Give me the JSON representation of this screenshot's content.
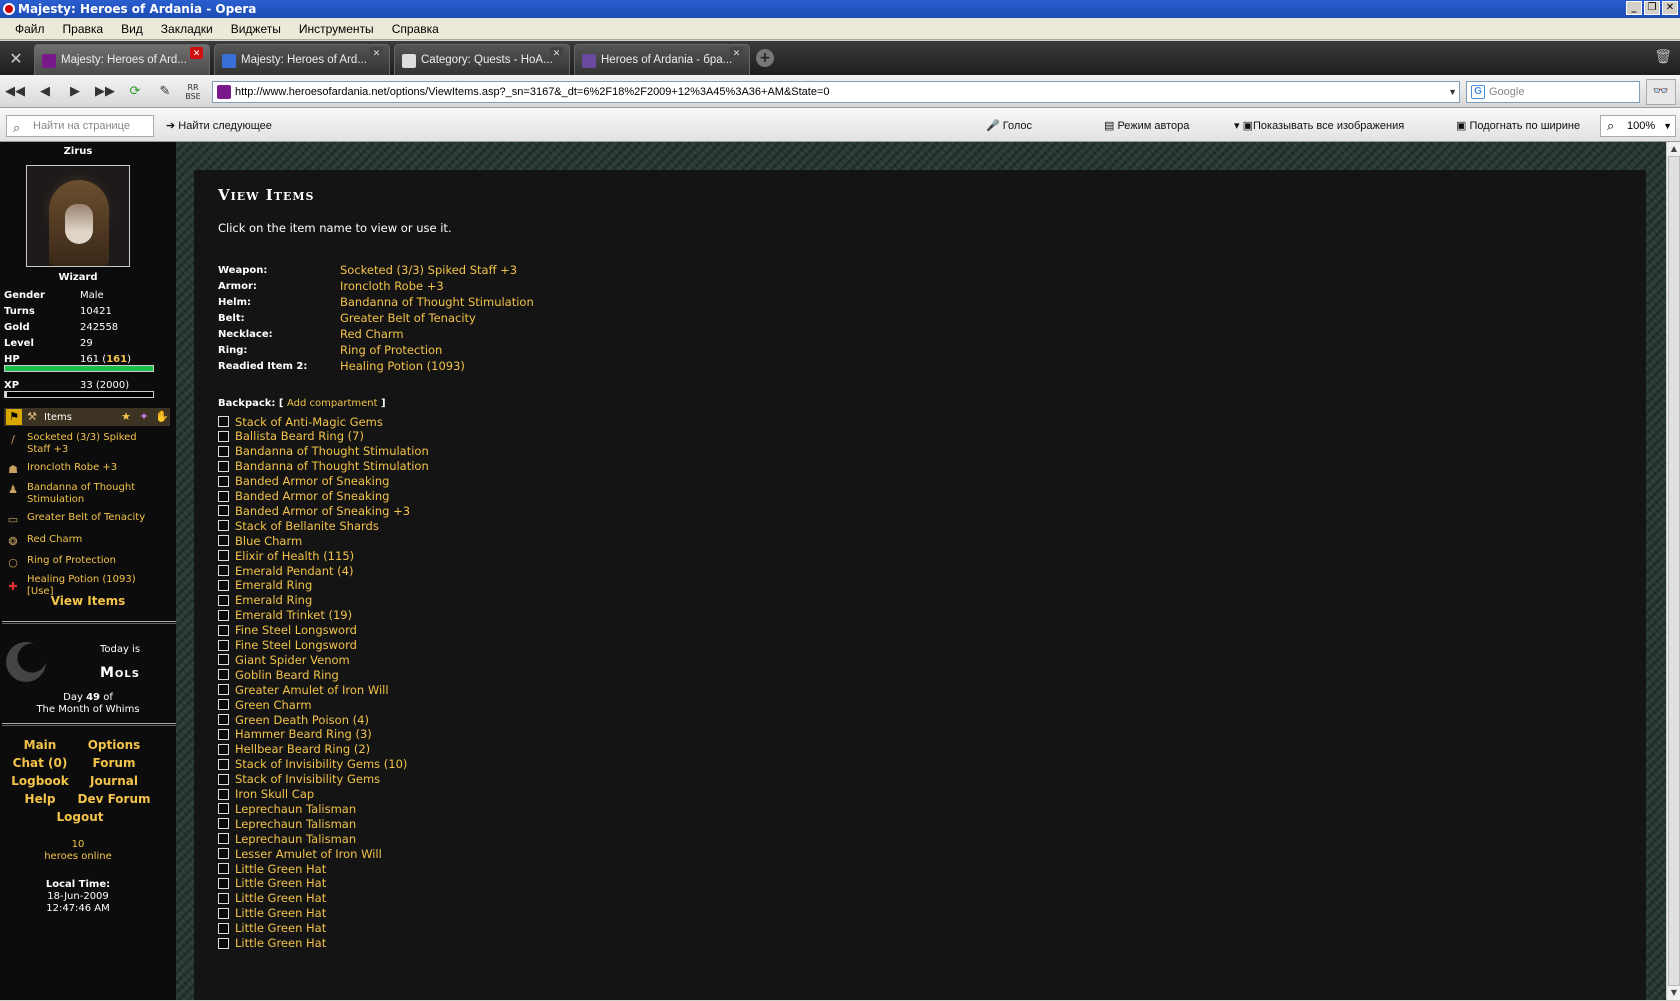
{
  "window": {
    "title": "Majesty: Heroes of Ardania - Opera"
  },
  "menu": [
    "Файл",
    "Правка",
    "Вид",
    "Закладки",
    "Виджеты",
    "Инструменты",
    "Справка"
  ],
  "tabs": [
    {
      "label": "Majesty: Heroes of Ard...",
      "active": true
    },
    {
      "label": "Majesty: Heroes of Ard..."
    },
    {
      "label": "Category: Quests - HoA..."
    },
    {
      "label": "Heroes of Ardania - бра..."
    }
  ],
  "address": {
    "url": "http://www.heroesofardania.net/options/ViewItems.asp?_sn=3167&_dt=6%2F18%2F2009+12%3A45%3A36+AM&State=0",
    "search_placeholder": "Google"
  },
  "findbar": {
    "find_placeholder": "Найти на странице",
    "find_next": "Найти следующее",
    "voice": "Голос",
    "author_mode": "Режим автора",
    "show_images": "Показывать все изображения",
    "fit_width": "Подогнать по ширине",
    "zoom": "100%"
  },
  "sidebar": {
    "name": "Zirus",
    "class": "Wizard",
    "stats": [
      {
        "label": "Gender",
        "value": "Male"
      },
      {
        "label": "Turns",
        "value": "10421"
      },
      {
        "label": "Gold",
        "value": "242558"
      },
      {
        "label": "Level",
        "value": "29"
      }
    ],
    "hp": {
      "label": "HP",
      "current": "161",
      "max": "161",
      "fraction": 1.0
    },
    "xp": {
      "label": "XP",
      "value": "33 (2000)",
      "fraction": 0.0165
    },
    "items_label": "Items",
    "equipped": [
      "Socketed (3/3) Spiked Staff +3",
      "Ironcloth Robe +3",
      "Bandanna of Thought Stimulation",
      "Greater Belt of Tenacity",
      "Red Charm",
      "Ring of Protection",
      "Healing Potion (1093) [Use]"
    ],
    "view_items": "View Items",
    "today_is": "Today is",
    "day_name": "Mols",
    "day_prefix": "Day",
    "day_number": "49",
    "day_of": "of",
    "month": "The Month of Whims",
    "nav": [
      "Main",
      "Options",
      "Chat (0)",
      "Forum",
      "Logbook",
      "Journal",
      "Help",
      "Dev Forum",
      "Logout"
    ],
    "online_count": "10",
    "online_label": "heroes online",
    "local_time_label": "Local Time:",
    "local_date": "18-Jun-2009",
    "local_time": "12:47:46 AM"
  },
  "main": {
    "title": "View Items",
    "subtitle": "Click on the item name to view or use it.",
    "equipment": [
      {
        "label": "Weapon:",
        "value": "Socketed (3/3) Spiked Staff +3"
      },
      {
        "label": "Armor:",
        "value": "Ironcloth Robe +3"
      },
      {
        "label": "Helm:",
        "value": "Bandanna of Thought Stimulation"
      },
      {
        "label": "Belt:",
        "value": "Greater Belt of Tenacity"
      },
      {
        "label": "Necklace:",
        "value": "Red Charm"
      },
      {
        "label": "Ring:",
        "value": "Ring of Protection"
      },
      {
        "label": "Readied Item 2:",
        "value": "Healing Potion (1093)"
      }
    ],
    "backpack_label": "Backpack:",
    "add_compartment": "Add compartment",
    "backpack": [
      "Stack of Anti-Magic Gems",
      "Ballista Beard Ring (7)",
      "Bandanna of Thought Stimulation",
      "Bandanna of Thought Stimulation",
      "Banded Armor of Sneaking",
      "Banded Armor of Sneaking",
      "Banded Armor of Sneaking +3",
      "Stack of Bellanite Shards",
      "Blue Charm",
      "Elixir of Health (115)",
      "Emerald Pendant (4)",
      "Emerald Ring",
      "Emerald Ring",
      "Emerald Trinket (19)",
      "Fine Steel Longsword",
      "Fine Steel Longsword",
      "Giant Spider Venom",
      "Goblin Beard Ring",
      "Greater Amulet of Iron Will",
      "Green Charm",
      "Green Death Poison (4)",
      "Hammer Beard Ring (3)",
      "Hellbear Beard Ring (2)",
      "Stack of Invisibility Gems (10)",
      "Stack of Invisibility Gems",
      "Iron Skull Cap",
      "Leprechaun Talisman",
      "Leprechaun Talisman",
      "Leprechaun Talisman",
      "Lesser Amulet of Iron Will",
      "Little Green Hat",
      "Little Green Hat",
      "Little Green Hat",
      "Little Green Hat",
      "Little Green Hat",
      "Little Green Hat"
    ]
  },
  "colors": {
    "link": "#f3c34a",
    "hp_bar": "#1bbf4a",
    "background": "#141414"
  }
}
